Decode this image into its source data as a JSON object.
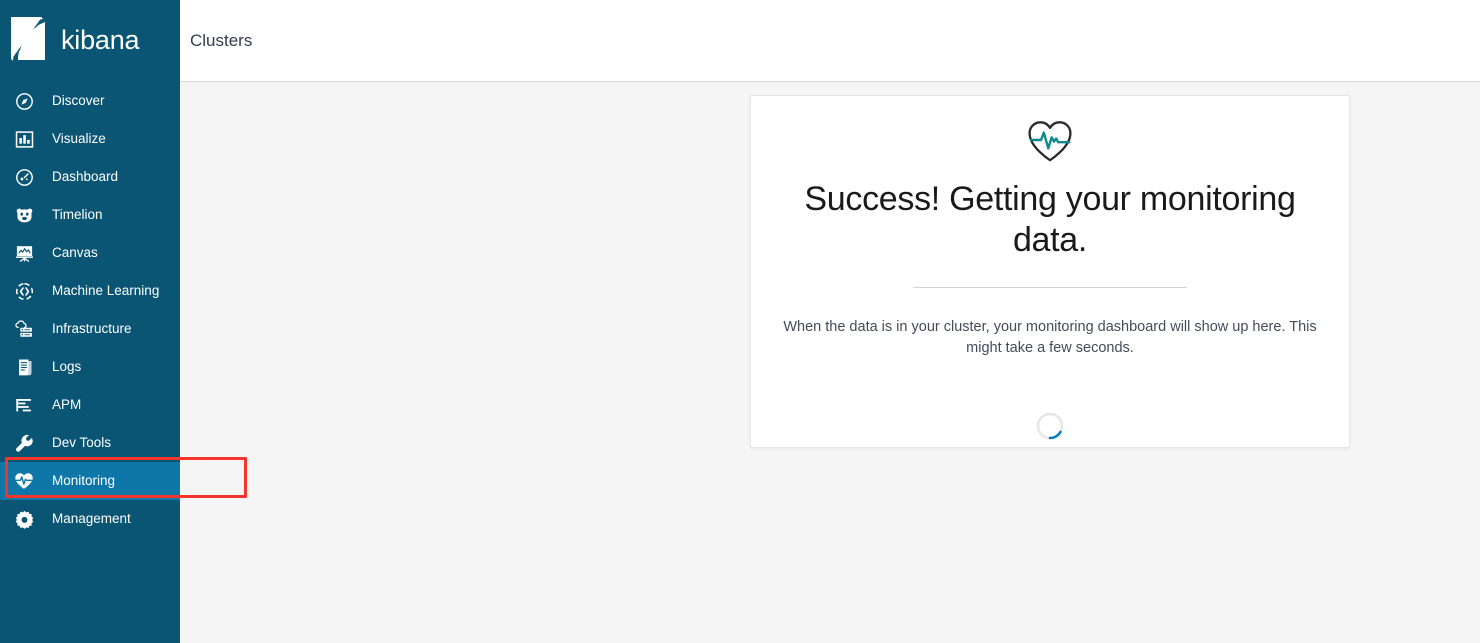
{
  "app": {
    "brand_name": "kibana",
    "logo_icon": "kibana-logo-icon"
  },
  "sidebar": {
    "background_color": "#0a5573",
    "active_background_color": "#0f77a8",
    "items": [
      {
        "label": "Discover",
        "icon": "compass-icon",
        "active": false
      },
      {
        "label": "Visualize",
        "icon": "bar-chart-icon",
        "active": false
      },
      {
        "label": "Dashboard",
        "icon": "gauge-circle-icon",
        "active": false
      },
      {
        "label": "Timelion",
        "icon": "bear-face-icon",
        "active": false
      },
      {
        "label": "Canvas",
        "icon": "easel-icon",
        "active": false
      },
      {
        "label": "Machine Learning",
        "icon": "brain-gear-icon",
        "active": false
      },
      {
        "label": "Infrastructure",
        "icon": "cloud-server-icon",
        "active": false
      },
      {
        "label": "Logs",
        "icon": "document-lines-icon",
        "active": false
      },
      {
        "label": "APM",
        "icon": "bars-align-icon",
        "active": false
      },
      {
        "label": "Dev Tools",
        "icon": "wrench-icon",
        "active": false
      },
      {
        "label": "Monitoring",
        "icon": "heart-pulse-icon",
        "active": true
      },
      {
        "label": "Management",
        "icon": "gear-icon",
        "active": false
      }
    ]
  },
  "header": {
    "breadcrumb": "Clusters",
    "breadcrumb_color": "#333d4d"
  },
  "card": {
    "icon": "heart-pulse-icon",
    "icon_accent_color": "#0f8a8a",
    "title": "Success! Getting your monitoring data.",
    "description": "When the data is in your cluster, your monitoring dashboard will show up here. This might take a few seconds.",
    "spinner_icon": "loading-spinner-icon",
    "spinner_color": "#0a7cb5"
  },
  "annotation": {
    "target": "Monitoring",
    "color": "#f5342e"
  }
}
